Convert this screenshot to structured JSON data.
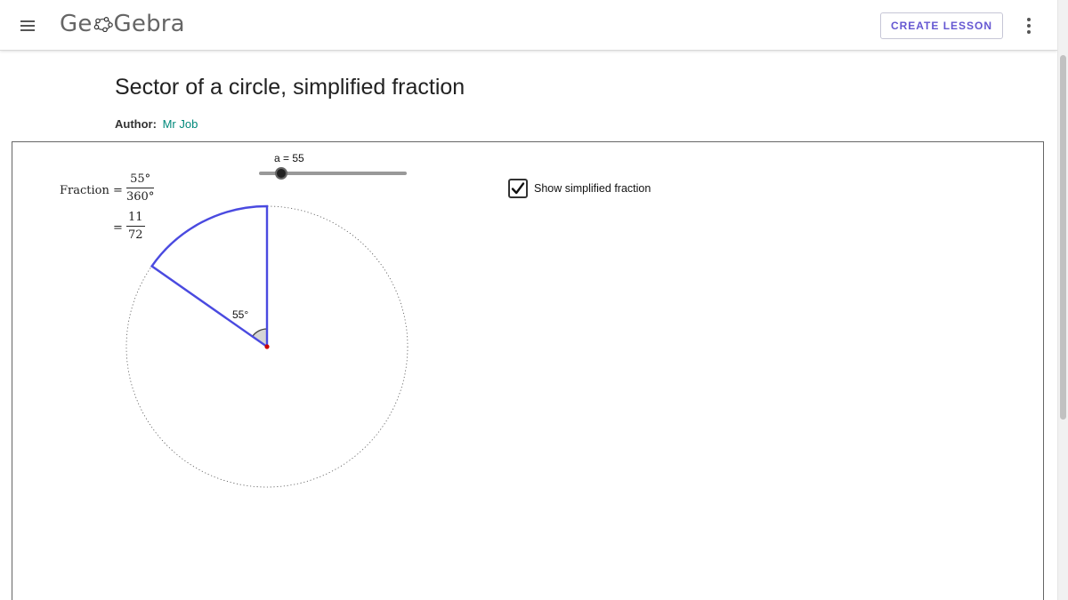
{
  "header": {
    "logo_text_left": "Ge",
    "logo_text_right": "Gebra",
    "create_lesson_label": "CREATE LESSON",
    "menu_icon": "hamburger-menu-icon",
    "more_icon": "vertical-dots-icon"
  },
  "page": {
    "title": "Sector of a circle, simplified fraction",
    "author_label": "Author:",
    "author_name": "Mr Job"
  },
  "applet": {
    "fraction_label": "Fraction =",
    "fraction_num": "55°",
    "fraction_den": "360°",
    "equals": "=",
    "simplified_num": "11",
    "simplified_den": "72",
    "slider_label": "a = 55",
    "slider": {
      "value": 55,
      "min": 0,
      "max": 360
    },
    "checkbox_label": "Show simplified fraction",
    "checkbox_checked": true,
    "angle_label": "55°",
    "angle_degrees": 55,
    "colors": {
      "sector": "#4a4ae0",
      "center_point": "#cc0000",
      "accent": "#6557d2",
      "author_link": "#00897b"
    }
  }
}
